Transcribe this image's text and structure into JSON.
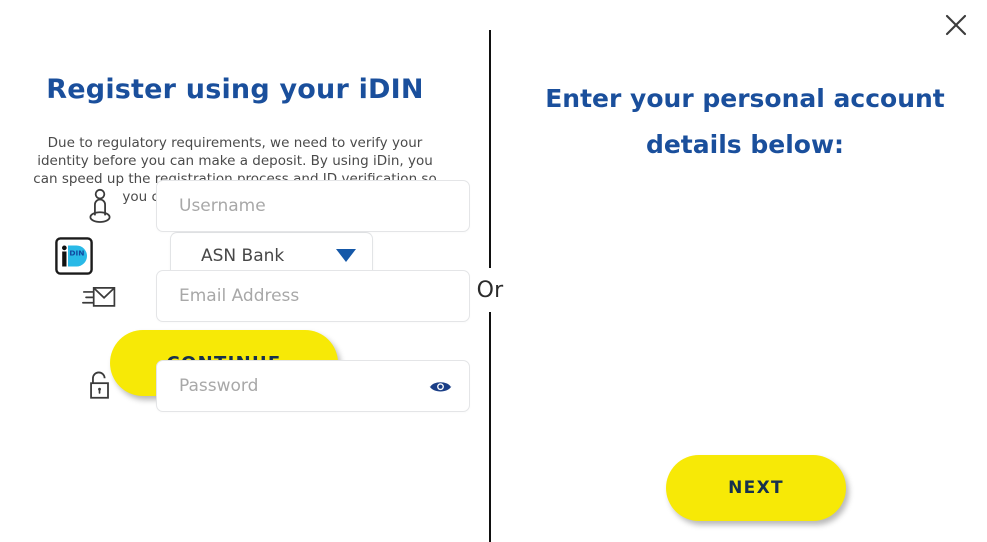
{
  "dialog": {
    "close_label": "Close",
    "divider_text": "Or"
  },
  "left": {
    "title": "Register using your iDIN",
    "description": "Due to regulatory requirements, we need to verify your identity before you can make a deposit. By using iDin, you can speed up the registration process and ID verification so you can make an instant deposit.",
    "logo_name": "idin-logo",
    "bank_select": {
      "selected": "ASN Bank",
      "options": [
        "ASN Bank"
      ]
    },
    "continue_label": "CONTINUE"
  },
  "right": {
    "title_line1": "Enter your personal account",
    "title_line2": "details below:",
    "fields": [
      {
        "name": "username",
        "placeholder": "Username",
        "value": "",
        "icon": "user-icon"
      },
      {
        "name": "email",
        "placeholder": "Email Address",
        "value": "",
        "icon": "email-send-icon"
      },
      {
        "name": "password",
        "placeholder": "Password",
        "value": "",
        "icon": "unlock-icon"
      }
    ],
    "show_password_label": "Show password",
    "next_label": "NEXT"
  },
  "colors": {
    "heading_blue": "#1a4f9c",
    "button_yellow": "#f7e906",
    "button_text": "#16304d",
    "eye_blue": "#1b3f87",
    "idin_cyan": "#29b9e7",
    "divider": "#111111"
  }
}
